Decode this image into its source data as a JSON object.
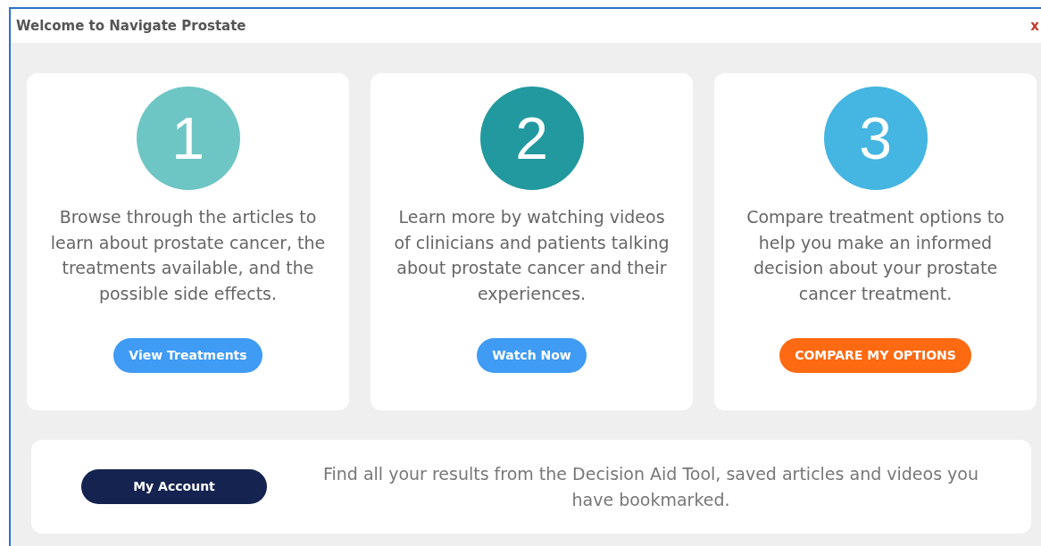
{
  "window": {
    "title": "Welcome to Navigate Prostate",
    "close": "x"
  },
  "steps": [
    {
      "number": "1",
      "color": "#6ec6c4",
      "text": "Browse through the articles to learn about prostate cancer, the treatments available, and the possible side effects.",
      "button": {
        "label": "View Treatments",
        "color": "#3f9bf4"
      }
    },
    {
      "number": "2",
      "color": "#22999e",
      "text": "Learn more by watching videos of clinicians and patients talking about prostate cancer and their experiences.",
      "button": {
        "label": "Watch Now",
        "color": "#3f9bf4"
      }
    },
    {
      "number": "3",
      "color": "#45b5e1",
      "text": "Compare treatment options to help you make an informed decision about your prostate cancer treatment.",
      "button": {
        "label": "COMPARE MY OPTIONS",
        "color": "#fd6a12"
      }
    }
  ],
  "account": {
    "button": "My Account",
    "text": "Find all your results from the Decision Aid Tool, saved articles and videos you have bookmarked."
  }
}
